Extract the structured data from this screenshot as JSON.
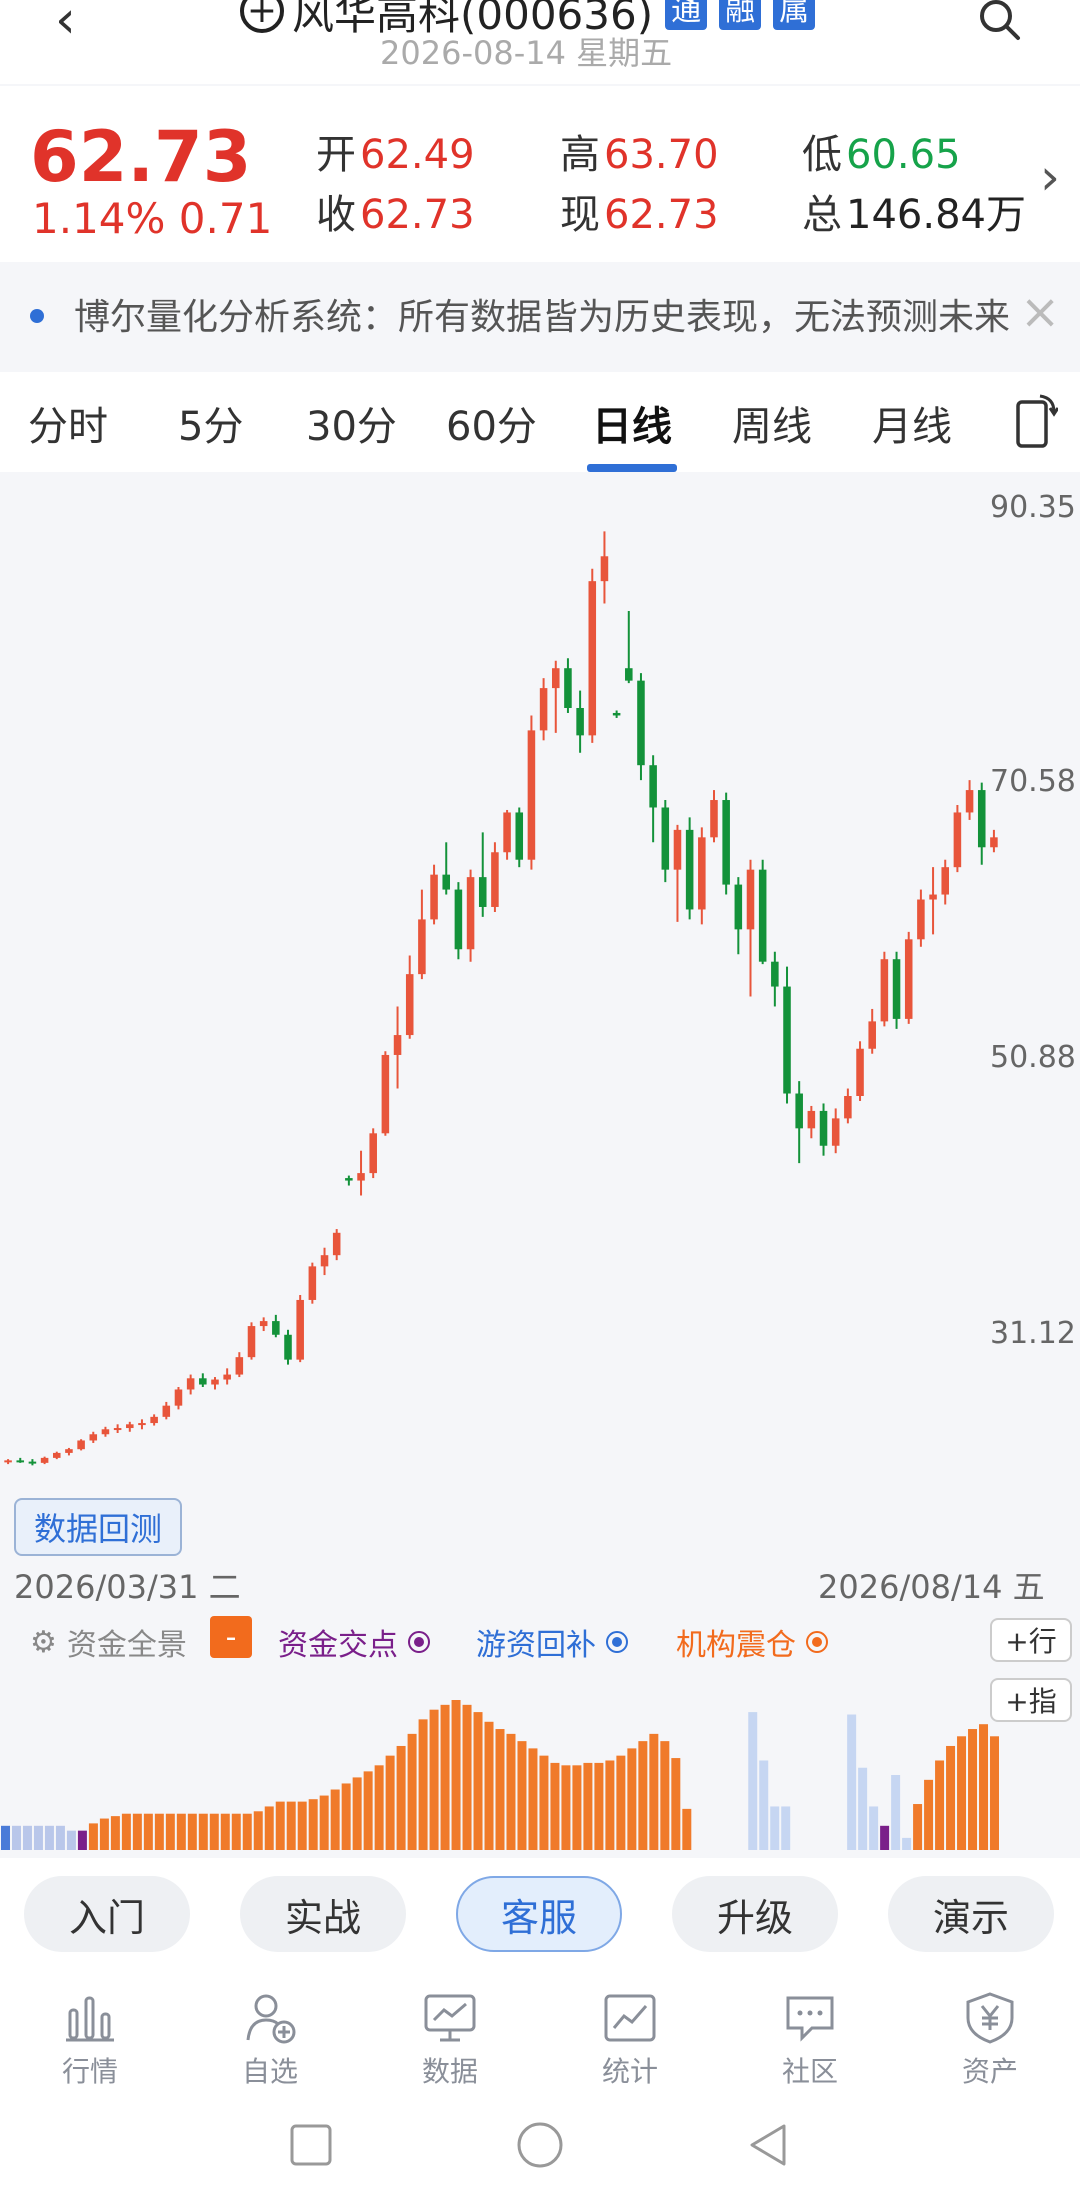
{
  "header": {
    "back_icon": "chevron-left-icon",
    "add_icon": "plus-circle-icon",
    "title": "风华高科(000636)",
    "tags": [
      "通",
      "融",
      "属"
    ],
    "date": "2026-08-14 星期五",
    "search_icon": "search-icon"
  },
  "quote": {
    "price": "62.73",
    "change": "1.14% 0.71",
    "open_label": "开",
    "open": "62.49",
    "high_label": "高",
    "high": "63.70",
    "low_label": "低",
    "low": "60.65",
    "close_label": "收",
    "close": "62.73",
    "current_label": "现",
    "current": "62.73",
    "total_label": "总",
    "total": "146.84万"
  },
  "notice": {
    "text": "博尔量化分析系统：所有数据皆为历史表现，无法预测未来"
  },
  "tabs": [
    "分时",
    "5分",
    "30分",
    "60分",
    "日线",
    "周线",
    "月线"
  ],
  "active_tab": "日线",
  "chart_data": {
    "type": "candlestick",
    "y_ticks": [
      "90.35",
      "70.58",
      "50.88",
      "31.12"
    ],
    "ylim": [
      14,
      92
    ],
    "start_date": "2026/03/31 二",
    "end_date": "2026/08/14 五",
    "up_color": "#e8553b",
    "down_color": "#13923a",
    "candles": [
      [
        15.8,
        16.0,
        15.6,
        15.9
      ],
      [
        15.9,
        16.1,
        15.7,
        15.8
      ],
      [
        15.8,
        16.0,
        15.5,
        15.7
      ],
      [
        15.7,
        16.2,
        15.6,
        16.1
      ],
      [
        16.1,
        16.6,
        16.0,
        16.5
      ],
      [
        16.5,
        16.9,
        16.3,
        16.8
      ],
      [
        16.8,
        17.6,
        16.7,
        17.5
      ],
      [
        17.5,
        18.2,
        17.3,
        18.0
      ],
      [
        18.0,
        18.6,
        17.8,
        18.4
      ],
      [
        18.4,
        18.8,
        18.1,
        18.5
      ],
      [
        18.5,
        19.0,
        18.2,
        18.8
      ],
      [
        18.8,
        19.2,
        18.4,
        18.9
      ],
      [
        18.9,
        19.6,
        18.7,
        19.4
      ],
      [
        19.4,
        20.6,
        19.2,
        20.3
      ],
      [
        20.3,
        21.8,
        20.0,
        21.6
      ],
      [
        21.6,
        22.8,
        21.2,
        22.5
      ],
      [
        22.5,
        22.9,
        21.8,
        22.0
      ],
      [
        22.0,
        22.6,
        21.6,
        22.4
      ],
      [
        22.4,
        23.3,
        22.0,
        22.8
      ],
      [
        22.8,
        24.6,
        22.6,
        24.2
      ],
      [
        24.2,
        27.0,
        24.0,
        26.7
      ],
      [
        26.7,
        27.4,
        26.3,
        27.1
      ],
      [
        27.1,
        27.6,
        25.8,
        26.0
      ],
      [
        26.0,
        26.4,
        23.6,
        24.0
      ],
      [
        24.0,
        29.2,
        23.8,
        28.8
      ],
      [
        28.8,
        31.8,
        28.5,
        31.5
      ],
      [
        31.5,
        33.0,
        30.8,
        32.4
      ],
      [
        32.4,
        34.5,
        32.0,
        34.2
      ],
      [
        38.6,
        38.8,
        38.0,
        38.4
      ],
      [
        38.4,
        40.8,
        37.2,
        39.0
      ],
      [
        39.0,
        42.6,
        38.6,
        42.2
      ],
      [
        42.2,
        48.8,
        42.0,
        48.5
      ],
      [
        48.5,
        52.4,
        45.8,
        50.1
      ],
      [
        50.1,
        56.5,
        49.8,
        55.0
      ],
      [
        55.0,
        61.8,
        54.6,
        59.4
      ],
      [
        59.4,
        63.8,
        59.0,
        63.0
      ],
      [
        63.0,
        65.6,
        61.4,
        61.8
      ],
      [
        61.8,
        62.4,
        56.2,
        57.0
      ],
      [
        57.0,
        63.4,
        56.0,
        62.8
      ],
      [
        62.8,
        66.4,
        59.6,
        60.4
      ],
      [
        60.4,
        65.6,
        60.0,
        64.8
      ],
      [
        64.8,
        68.2,
        64.2,
        68.0
      ],
      [
        68.0,
        68.4,
        63.6,
        64.2
      ],
      [
        64.2,
        75.8,
        63.4,
        74.6
      ],
      [
        74.6,
        78.8,
        73.8,
        78.0
      ],
      [
        78.0,
        80.2,
        74.4,
        79.6
      ],
      [
        79.6,
        80.4,
        76.0,
        76.4
      ],
      [
        76.4,
        77.8,
        72.8,
        74.2
      ],
      [
        74.2,
        87.6,
        73.6,
        86.6
      ],
      [
        86.6,
        90.6,
        84.8,
        88.6
      ],
      [
        76.0,
        76.2,
        75.6,
        75.8
      ],
      [
        79.6,
        84.2,
        78.4,
        78.6
      ],
      [
        78.6,
        79.2,
        70.6,
        71.8
      ],
      [
        71.8,
        72.6,
        65.6,
        68.4
      ],
      [
        68.4,
        69.0,
        62.4,
        63.4
      ],
      [
        63.4,
        67.0,
        59.2,
        66.6
      ],
      [
        66.6,
        67.6,
        59.4,
        60.2
      ],
      [
        60.2,
        66.8,
        59.0,
        66.0
      ],
      [
        66.0,
        69.8,
        65.6,
        69.0
      ],
      [
        69.0,
        69.6,
        61.4,
        62.2
      ],
      [
        62.2,
        62.8,
        56.6,
        58.6
      ],
      [
        58.6,
        64.2,
        53.2,
        63.4
      ],
      [
        63.4,
        64.2,
        55.8,
        56.0
      ],
      [
        56.0,
        56.8,
        52.4,
        54.0
      ],
      [
        54.0,
        55.6,
        44.6,
        45.4
      ],
      [
        45.4,
        46.4,
        39.8,
        42.6
      ],
      [
        42.6,
        44.4,
        41.8,
        44.0
      ],
      [
        44.0,
        44.6,
        40.4,
        41.2
      ],
      [
        41.2,
        44.2,
        40.6,
        43.4
      ],
      [
        43.4,
        45.8,
        43.0,
        45.2
      ],
      [
        45.2,
        49.6,
        44.8,
        49.0
      ],
      [
        49.0,
        52.2,
        48.6,
        51.2
      ],
      [
        51.2,
        56.8,
        50.8,
        56.2
      ],
      [
        56.2,
        56.8,
        50.6,
        51.4
      ],
      [
        51.4,
        58.4,
        51.0,
        57.8
      ],
      [
        57.8,
        61.8,
        57.2,
        61.0
      ],
      [
        61.0,
        63.6,
        58.2,
        61.4
      ],
      [
        61.4,
        64.2,
        60.6,
        63.6
      ],
      [
        63.6,
        68.6,
        63.2,
        68.0
      ],
      [
        68.0,
        70.6,
        67.4,
        69.8
      ],
      [
        69.8,
        70.4,
        63.8,
        65.2
      ],
      [
        65.2,
        66.6,
        64.8,
        66.0
      ]
    ]
  },
  "backtest_label": "数据回测",
  "indicator": {
    "title": "资金全景",
    "minus": "-",
    "items": [
      {
        "label": "资金交点",
        "color": "#7a1f8a"
      },
      {
        "label": "游资回补",
        "color": "#2f6fd6"
      },
      {
        "label": "机构震仓",
        "color": "#f26b1d"
      }
    ],
    "row_button": "+行",
    "index_button": "+指"
  },
  "volume": {
    "values": [
      2,
      2,
      2,
      2,
      2,
      2,
      1.6,
      1.6,
      2.2,
      2.6,
      2.8,
      3,
      3,
      3,
      3,
      3,
      3,
      3,
      3,
      3,
      3,
      3,
      3,
      3.2,
      3.6,
      4,
      4,
      4,
      4.2,
      4.5,
      5,
      5.5,
      6,
      6.5,
      7,
      7.8,
      8.6,
      9.6,
      10.8,
      11.6,
      12,
      12.4,
      12,
      11.4,
      10.6,
      10,
      9.6,
      9,
      8.4,
      7.8,
      7.2,
      7,
      7,
      7.2,
      7.2,
      7.4,
      7.8,
      8.4,
      9,
      9.6,
      9,
      7.6,
      3.4,
      0,
      0,
      0,
      0,
      0,
      11.4,
      7.4,
      3.6,
      3.6,
      0,
      0,
      0,
      0,
      0,
      11.2,
      6.8,
      3.6,
      2,
      6.2,
      1,
      3.8,
      5.8,
      7.4,
      8.6,
      9.4,
      10,
      10.4,
      9.4
    ],
    "colors_key": "orange=up-flow, light-blue=down-flow, purple=cross"
  },
  "pills": [
    "入门",
    "实战",
    "客服",
    "升级",
    "演示"
  ],
  "active_pill": "客服",
  "nav": [
    {
      "label": "行情",
      "icon": "bar-chart-icon"
    },
    {
      "label": "自选",
      "icon": "user-add-icon"
    },
    {
      "label": "数据",
      "icon": "monitor-chart-icon"
    },
    {
      "label": "统计",
      "icon": "trend-icon"
    },
    {
      "label": "社区",
      "icon": "chat-bubble-icon"
    },
    {
      "label": "资产",
      "icon": "yen-shield-icon"
    }
  ],
  "system": {
    "square": "recent-apps-icon",
    "circle": "home-icon",
    "triangle": "back-icon"
  }
}
